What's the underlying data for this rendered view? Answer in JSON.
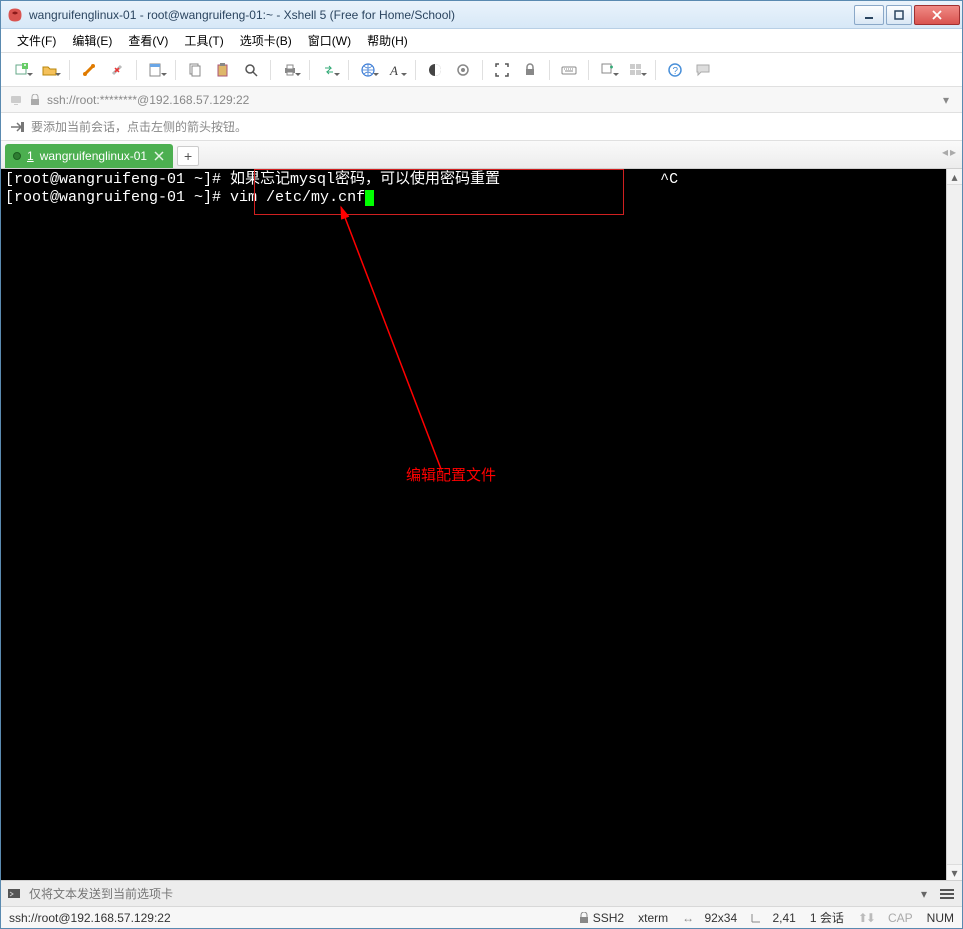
{
  "window": {
    "title": "wangruifenglinux-01 - root@wangruifeng-01:~ - Xshell 5 (Free for Home/School)"
  },
  "menu": {
    "file": {
      "label": "文件",
      "key": "(F)"
    },
    "edit": {
      "label": "编辑",
      "key": "(E)"
    },
    "view": {
      "label": "查看",
      "key": "(V)"
    },
    "tools": {
      "label": "工具",
      "key": "(T)"
    },
    "tabs": {
      "label": "选项卡",
      "key": "(B)"
    },
    "window": {
      "label": "窗口",
      "key": "(W)"
    },
    "help": {
      "label": "帮助",
      "key": "(H)"
    }
  },
  "addressbar": {
    "url": "ssh://root:********@192.168.57.129:22"
  },
  "hintbar": {
    "text": "要添加当前会话，点击左侧的箭头按钮。"
  },
  "tabs": {
    "active": {
      "index": "1",
      "label": "wangruifenglinux-01"
    }
  },
  "terminal": {
    "prompt": "[root@wangruifeng-01 ~]# ",
    "line1_cmd": "如果忘记mysql密码，可以使用密码重置",
    "line1_tail": "^C",
    "line2_cmd": "vim /etc/my.cnf"
  },
  "annotation": {
    "label": "编辑配置文件"
  },
  "sendbar": {
    "placeholder": "仅将文本发送到当前选项卡"
  },
  "statusbar": {
    "conn": "ssh://root@192.168.57.129:22",
    "proto": "SSH2",
    "term": "xterm",
    "size": "92x34",
    "cursor": "2,41",
    "sessions": "1 会话",
    "cap": "CAP",
    "num": "NUM"
  }
}
